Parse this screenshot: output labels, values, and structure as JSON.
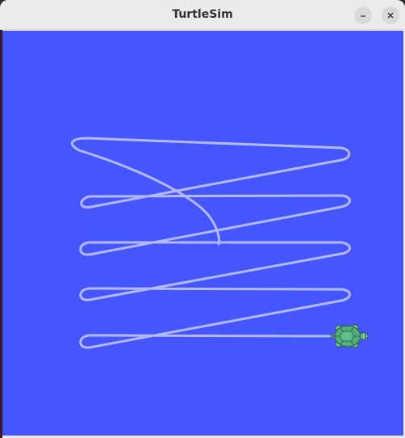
{
  "window": {
    "title": "TurtleSim",
    "background_color": "#4556ff",
    "pen_color": "#b3b8ff",
    "buttons": [
      {
        "name": "minimize",
        "icon": "minimize-icon"
      },
      {
        "name": "close",
        "icon": "close-icon"
      }
    ]
  },
  "turtle": {
    "icon": "turtle-icon",
    "shell_color": "#4fae7a",
    "heading": "east"
  }
}
